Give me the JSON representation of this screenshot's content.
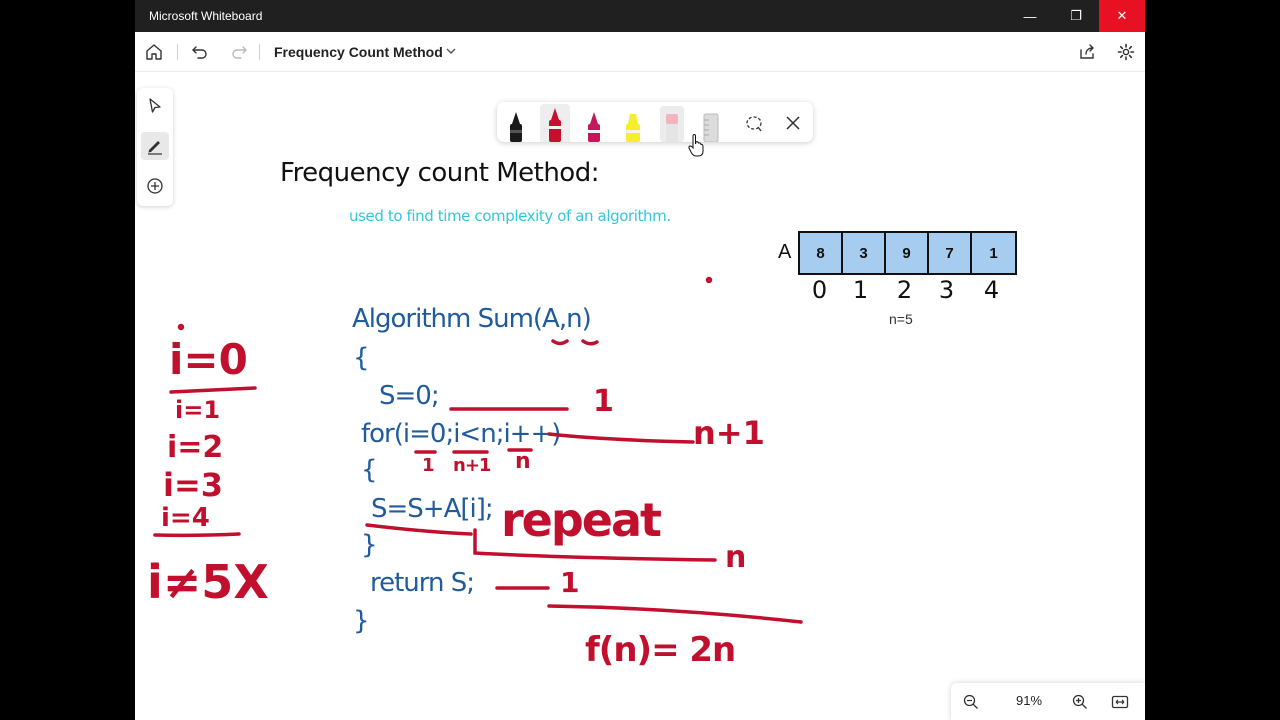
{
  "window": {
    "title": "Microsoft Whiteboard",
    "controls": [
      "—",
      "❐",
      "✕"
    ]
  },
  "toolbar": {
    "board_title": "Frequency Count Method"
  },
  "pens": [
    {
      "name": "black-pen",
      "color": "#1a1a1a"
    },
    {
      "name": "red-pen",
      "color": "#c8102e",
      "selected": true
    },
    {
      "name": "magenta-pen",
      "color": "#c2185b"
    },
    {
      "name": "highlighter-yellow",
      "color": "#f4ef2a"
    },
    {
      "name": "eraser",
      "color": "#f4b3bf"
    },
    {
      "name": "ruler",
      "color": "#d8d8d8"
    }
  ],
  "canvas": {
    "heading": "Frequency count Method:",
    "subtitle": "used to find time complexity of an algorithm.",
    "array": {
      "label": "A",
      "values": [
        "8",
        "3",
        "9",
        "7",
        "1"
      ],
      "indices": [
        "0",
        "1",
        "2",
        "3",
        "4"
      ],
      "size_note": "n=5"
    },
    "code": {
      "line1": "Algorithm Sum(A,n)",
      "line2": "{",
      "line3": "S=0;",
      "line4": "for(i=0;i<n;i++)",
      "line5": "{",
      "line6": "S=S+A[i];",
      "line7": "}",
      "line8": "return S;",
      "line9": "}"
    },
    "annotations": {
      "counts": [
        "1",
        "n+1",
        "1",
        "n+1",
        "n",
        "repeat",
        "n",
        "1"
      ],
      "formula": "f(n)= 2n",
      "trace": [
        "i=0",
        "i=1",
        "i=2",
        "i=3",
        "i=4",
        "i≠5X"
      ]
    }
  },
  "zoom": {
    "level": "91%"
  },
  "colors": {
    "titlebar": "#202020",
    "close": "#e81123",
    "code_ink": "#1f5c9e",
    "red_ink": "#c0102e",
    "subtitle_ink": "#33c6d8",
    "cell_fill": "#a6cdf0"
  }
}
